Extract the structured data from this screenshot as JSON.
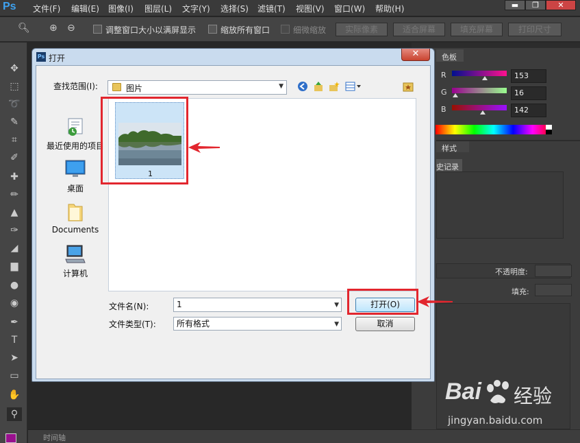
{
  "app": {
    "logo": "Ps",
    "menu": [
      "文件(F)",
      "编辑(E)",
      "图像(I)",
      "图层(L)",
      "文字(Y)",
      "选择(S)",
      "滤镜(T)",
      "视图(V)",
      "窗口(W)",
      "帮助(H)"
    ],
    "window_buttons": [
      "▬",
      "❐",
      "✕"
    ]
  },
  "options_bar": {
    "checkbox_fit_window": "调整窗口大小以满屏显示",
    "checkbox_zoom_all": "缩放所有窗口",
    "checkbox_scrubby": "细微缩放",
    "buttons": [
      "实际像素",
      "适合屏幕",
      "填充屏幕",
      "打印尺寸"
    ]
  },
  "panels": {
    "color_tab": "色板",
    "r_label": "R",
    "r_value": "153",
    "r_level": 0.6,
    "g_label": "G",
    "g_value": "16",
    "g_level": 0.06,
    "b_label": "B",
    "b_value": "142",
    "b_level": 0.56,
    "styles_tab": "样式",
    "history_tab": "史记录",
    "opacity_label": "不透明度:",
    "fill_label": "填充:"
  },
  "timeline": {
    "label": "时间轴"
  },
  "dialog": {
    "title": "打开",
    "close_glyph": "✕",
    "look_in_label": "查找范围(I):",
    "look_in_value": "图片",
    "places": [
      {
        "label": "最近使用的项目",
        "icon": "recent-icon"
      },
      {
        "label": "桌面",
        "icon": "desktop-icon"
      },
      {
        "label": "Documents",
        "icon": "documents-folder-icon"
      },
      {
        "label": "计算机",
        "icon": "computer-icon"
      }
    ],
    "files": [
      {
        "name": "1"
      }
    ],
    "file_name_label": "文件名(N):",
    "file_name_value": "1",
    "file_type_label": "文件类型(T):",
    "file_type_value": "所有格式",
    "open_button": "打开(O)",
    "cancel_button": "取消"
  },
  "watermark": {
    "brand": "Bai",
    "brand_cn": "经验",
    "url": "jingyan.baidu.com"
  },
  "colors": {
    "annotation": "#e2262e",
    "foreground_swatch": "#99108e"
  }
}
